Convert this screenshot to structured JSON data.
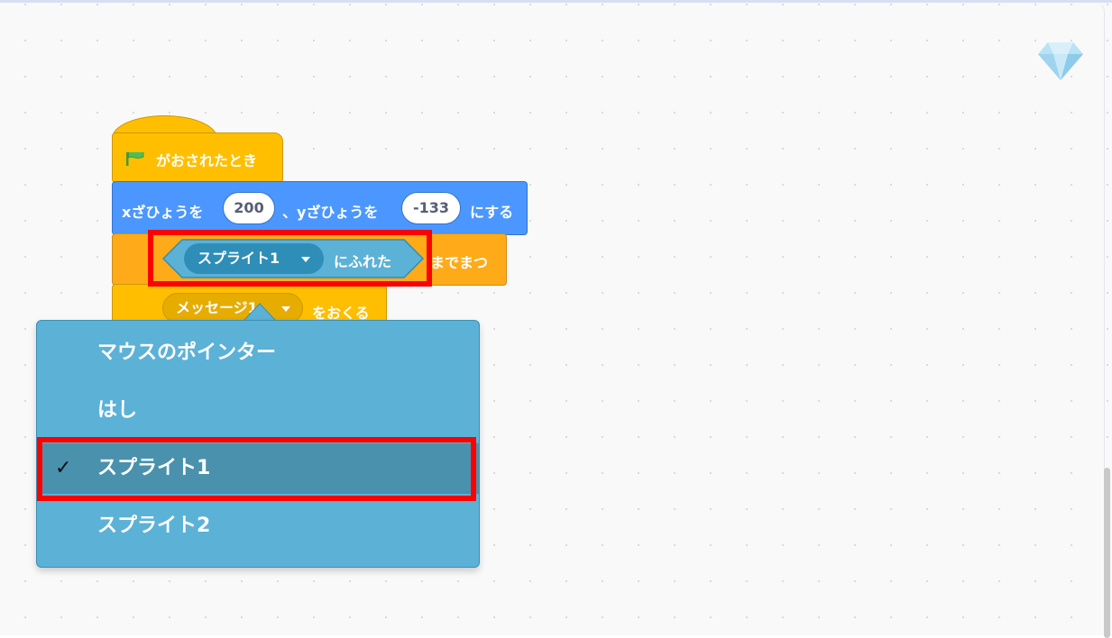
{
  "colors": {
    "events": "#ffbf00",
    "motion": "#4c97ff",
    "control": "#ffab19",
    "sensing": "#5cb1d6",
    "highlight": "#ff0000"
  },
  "blocks": {
    "when_flag": {
      "icon": "green-flag-icon",
      "label": "がおされたとき"
    },
    "go_to_xy": {
      "x_prefix": "xざひょうを",
      "x_value": "200",
      "y_prefix": "、yざひょうを",
      "y_value": "-133",
      "suffix": "にする"
    },
    "wait_until": {
      "sprite_dropdown": "スプライト1",
      "touching_label": "にふれた",
      "suffix": "までまつ"
    },
    "broadcast": {
      "message_dropdown": "メッセージ1",
      "suffix": "をおくる"
    }
  },
  "dropdown_menu": {
    "items": [
      {
        "label": "マウスのポインター",
        "selected": false
      },
      {
        "label": "はし",
        "selected": false
      },
      {
        "label": "スプライト1",
        "selected": true
      },
      {
        "label": "スプライト2",
        "selected": false
      }
    ],
    "check_mark": "✓"
  }
}
